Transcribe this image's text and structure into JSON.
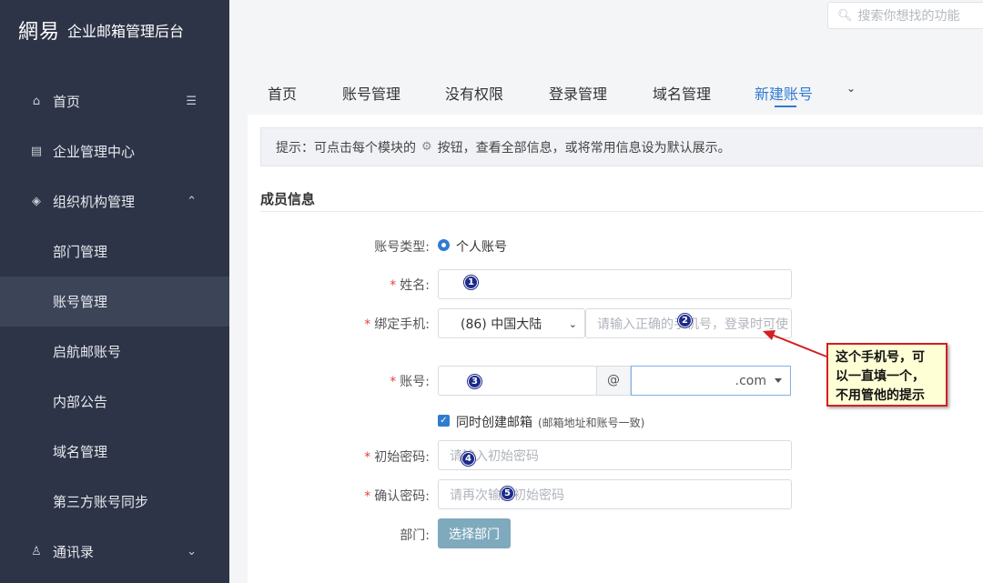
{
  "sidebar": {
    "logo": "網易",
    "title": "企业邮箱管理后台",
    "items": [
      {
        "label": "首页",
        "icon": "home-icon",
        "right": "collapse-icon"
      },
      {
        "label": "企业管理中心",
        "icon": "building-icon"
      },
      {
        "label": "组织机构管理",
        "icon": "layers-icon",
        "right": "chevron-up-icon"
      },
      {
        "label": "部门管理"
      },
      {
        "label": "账号管理",
        "active": true
      },
      {
        "label": "启航邮账号"
      },
      {
        "label": "内部公告"
      },
      {
        "label": "域名管理"
      },
      {
        "label": "第三方账号同步"
      },
      {
        "label": "通讯录",
        "icon": "user-icon",
        "right": "chevron-down-icon"
      }
    ]
  },
  "search": {
    "placeholder": "搜索你想找的功能"
  },
  "tabs": [
    "首页",
    "账号管理",
    "没有权限",
    "登录管理",
    "域名管理",
    "新建账号"
  ],
  "active_tab": "新建账号",
  "tip": {
    "prefix": "提示：可点击每个模块的",
    "suffix": "按钮，查看全部信息，或将常用信息设为默认展示。"
  },
  "section_title": "成员信息",
  "form": {
    "account_type_label": "账号类型:",
    "account_type_value": "个人账号",
    "name_label": "姓名:",
    "phone_label": "绑定手机:",
    "phone_country": "(86) 中国大陆",
    "phone_placeholder": "请输入正确的手机号，登录时可使",
    "account_label": "账号:",
    "at": "@",
    "domain_suffix": ".com",
    "create_mailbox_label": "同时创建邮箱",
    "create_mailbox_hint": "(邮箱地址和账号一致)",
    "password_label": "初始密码:",
    "password_placeholder": "请输入初始密码",
    "confirm_label": "确认密码:",
    "confirm_placeholder": "请再次输入初始密码",
    "dept_label": "部门:",
    "dept_button": "选择部门"
  },
  "annotations": {
    "badges": [
      "1",
      "2",
      "3",
      "4",
      "5"
    ],
    "callout": "这个手机号，可以一直填一个，不用管他的提示",
    "callout_lines": [
      "这个手机号，可",
      "以一直填一个，",
      "不用管他的提示"
    ]
  }
}
